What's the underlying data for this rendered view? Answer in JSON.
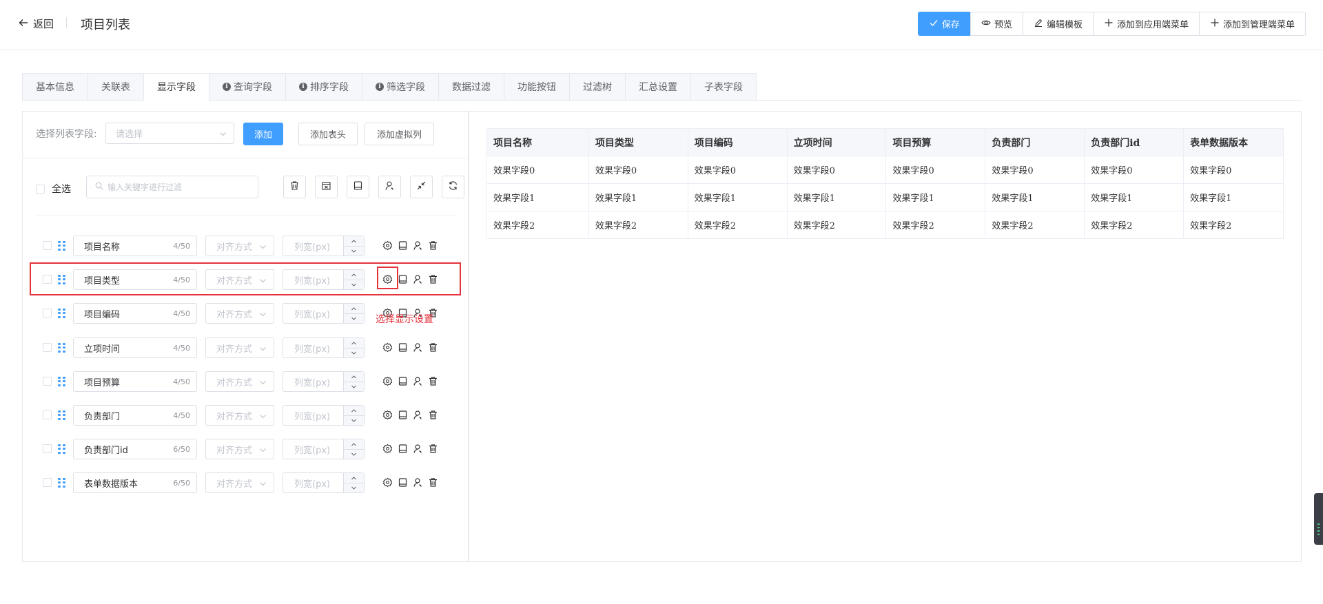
{
  "header": {
    "back_label": "返回",
    "title": "项目列表",
    "buttons": {
      "save": "保存",
      "preview": "预览",
      "edit_template": "编辑模板",
      "add_app_menu": "添加到应用端菜单",
      "add_admin_menu": "添加到管理端菜单"
    }
  },
  "tabs": [
    {
      "label": "基本信息"
    },
    {
      "label": "关联表"
    },
    {
      "label": "显示字段",
      "active": true
    },
    {
      "label": "查询字段",
      "info": true
    },
    {
      "label": "排序字段",
      "info": true
    },
    {
      "label": "筛选字段",
      "info": true
    },
    {
      "label": "数据过滤"
    },
    {
      "label": "功能按钮"
    },
    {
      "label": "过滤树"
    },
    {
      "label": "汇总设置"
    },
    {
      "label": "子表字段"
    }
  ],
  "left": {
    "select_label": "选择列表字段:",
    "select_placeholder": "请选择",
    "add_button": "添加",
    "add_header_button": "添加表头",
    "add_virtual_button": "添加虚拟列",
    "select_all": "全选",
    "search_placeholder": "输入关键字进行过滤",
    "align_placeholder": "对齐方式",
    "width_placeholder": "列宽(px)",
    "fields": [
      {
        "name": "项目名称",
        "count": "4/50"
      },
      {
        "name": "项目类型",
        "count": "4/50"
      },
      {
        "name": "项目编码",
        "count": "4/50"
      },
      {
        "name": "立项时间",
        "count": "4/50"
      },
      {
        "name": "项目预算",
        "count": "4/50"
      },
      {
        "name": "负责部门",
        "count": "4/50"
      },
      {
        "name": "负责部门id",
        "count": "6/50"
      },
      {
        "name": "表单数据版本",
        "count": "6/50"
      }
    ],
    "annotation": "选择显示设置"
  },
  "preview_table": {
    "headers": [
      "项目名称",
      "项目类型",
      "项目编码",
      "立项时间",
      "项目预算",
      "负责部门",
      "负责部门id",
      "表单数据版本"
    ],
    "rows": [
      [
        "效果字段0",
        "效果字段0",
        "效果字段0",
        "效果字段0",
        "效果字段0",
        "效果字段0",
        "效果字段0",
        "效果字段0"
      ],
      [
        "效果字段1",
        "效果字段1",
        "效果字段1",
        "效果字段1",
        "效果字段1",
        "效果字段1",
        "效果字段1",
        "效果字段1"
      ],
      [
        "效果字段2",
        "效果字段2",
        "效果字段2",
        "效果字段2",
        "效果字段2",
        "效果字段2",
        "效果字段2",
        "效果字段2"
      ]
    ]
  },
  "colors": {
    "primary": "#409eff",
    "annotation_red": "#e5323c"
  }
}
